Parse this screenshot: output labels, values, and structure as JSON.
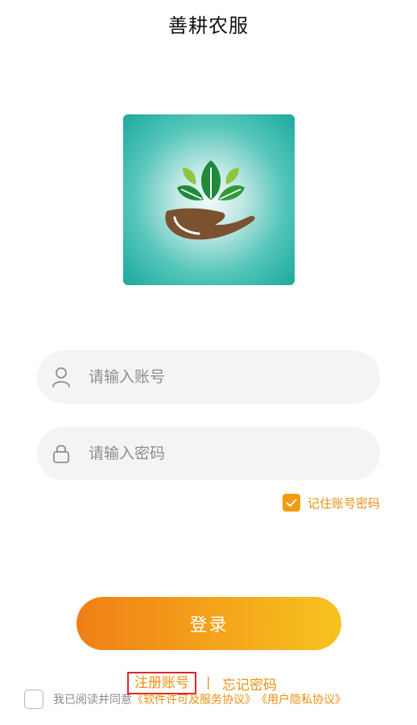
{
  "header": {
    "title": "善耕农服"
  },
  "logo": {
    "icon": "leaf-hand-logo"
  },
  "account_field": {
    "placeholder": "请输入账号",
    "icon": "user-icon"
  },
  "password_field": {
    "placeholder": "请输入密码",
    "icon": "lock-icon"
  },
  "remember": {
    "label": "记住账号密码",
    "checked": true
  },
  "login": {
    "label": "登录"
  },
  "links": {
    "register": "注册账号",
    "divider": "|",
    "forgot": "忘记密码"
  },
  "agreement": {
    "checked": false,
    "prefix": "我已阅读并同意",
    "license": "《软件许可及服务协议》",
    "privacy": "《用户隐私协议》"
  },
  "colors": {
    "accent": "#ef8f12",
    "button_start": "#ef7f16",
    "button_end": "#f6c31f",
    "logo_teal": "#1aa99c",
    "highlight_box": "#e0252c"
  }
}
